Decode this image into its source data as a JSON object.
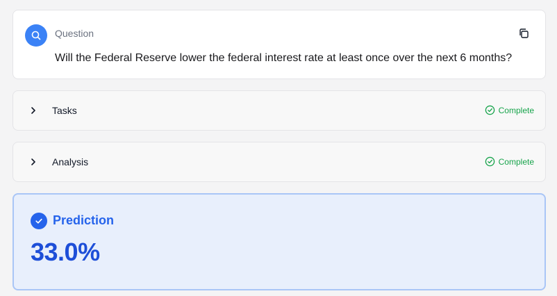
{
  "question": {
    "label": "Question",
    "text": "Will the Federal Reserve lower the federal interest rate at least once over the next 6 months?",
    "icon": "search-icon",
    "copy_icon": "copy-icon"
  },
  "sections": [
    {
      "label": "Tasks",
      "status": "Complete",
      "status_icon": "check-circle-icon"
    },
    {
      "label": "Analysis",
      "status": "Complete",
      "status_icon": "check-circle-icon"
    }
  ],
  "prediction": {
    "label": "Prediction",
    "value": "33.0%",
    "icon": "check-circle-icon"
  },
  "colors": {
    "accent": "#3b82f6",
    "prediction_text": "#2563eb",
    "prediction_bg": "#e8effc",
    "status_green": "#16a34a"
  }
}
